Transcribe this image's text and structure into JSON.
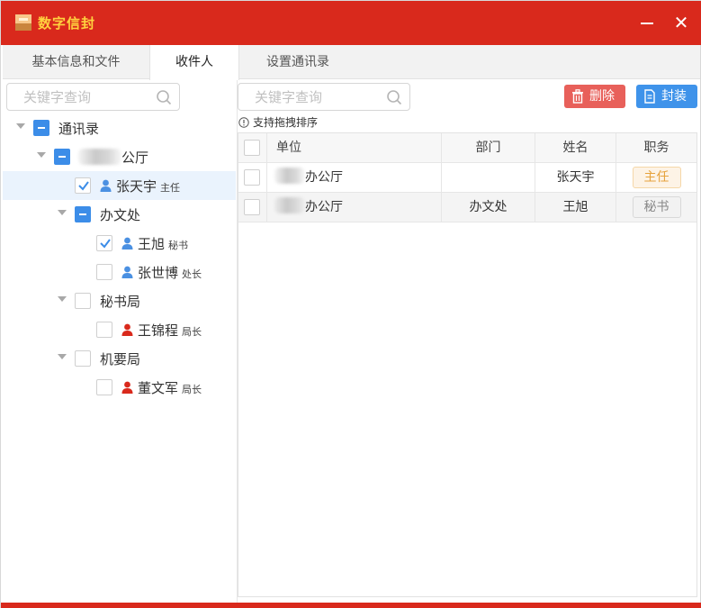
{
  "window": {
    "title": "数字信封",
    "brand_color": "#d9291c",
    "title_color": "#ffd23f",
    "close_glyph": "✕"
  },
  "tabs": [
    {
      "label": "基本信息和文件",
      "active": false
    },
    {
      "label": "收件人",
      "active": true
    },
    {
      "label": "设置通讯录",
      "active": false
    }
  ],
  "left": {
    "search_placeholder": "关键字查询",
    "tree": {
      "root": {
        "label": "通讯录",
        "state": "partial"
      },
      "office": {
        "label_suffix": "公厅",
        "state": "partial"
      },
      "office_member": {
        "name": "张天宇",
        "role": "主任",
        "checked": true,
        "icon": "person-blue-icon"
      },
      "dept1": {
        "label": "办文处",
        "state": "partial"
      },
      "dept1_members": [
        {
          "name": "王旭",
          "role": "秘书",
          "checked": true,
          "icon": "person-blue-icon"
        },
        {
          "name": "张世博",
          "role": "处长",
          "checked": false,
          "icon": "person-blue-icon"
        }
      ],
      "dept2": {
        "label": "秘书局",
        "state": "none"
      },
      "dept2_members": [
        {
          "name": "王锦程",
          "role": "局长",
          "checked": false,
          "icon": "person-red-icon"
        }
      ],
      "dept3": {
        "label": "机要局",
        "state": "none"
      },
      "dept3_members": [
        {
          "name": "董文军",
          "role": "局长",
          "checked": false,
          "icon": "person-red-icon"
        }
      ]
    }
  },
  "right": {
    "search_placeholder": "关键字查询",
    "delete_label": "删除",
    "seal_label": "封装",
    "hint": "支持拖拽排序",
    "columns": [
      "单位",
      "部门",
      "姓名",
      "职务"
    ],
    "rows": [
      {
        "unit_suffix": "办公厅",
        "dept": "",
        "name": "张天宇",
        "title": "主任",
        "title_style": "warm"
      },
      {
        "unit_suffix": "办公厅",
        "dept": "办文处",
        "name": "王旭",
        "title": "秘书",
        "title_style": "gray"
      }
    ]
  }
}
